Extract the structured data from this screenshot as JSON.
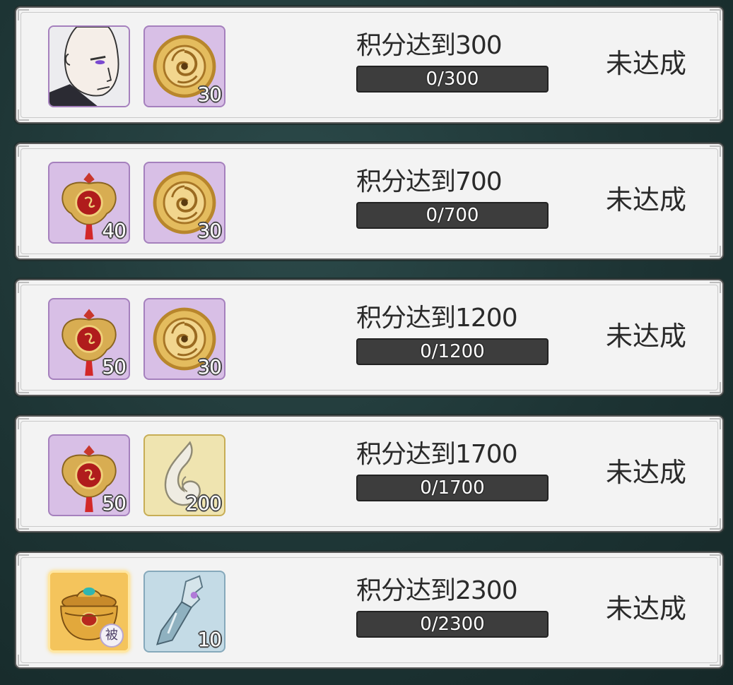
{
  "tasks": [
    {
      "title": "积分达到300",
      "progress_text": "0/300",
      "progress": 0,
      "status": "未达成",
      "rewards": [
        {
          "icon": "character-portrait-icon",
          "frame": "purple",
          "count": ""
        },
        {
          "icon": "gold-coin-icon",
          "frame": "purple",
          "count": "30"
        }
      ]
    },
    {
      "title": "积分达到700",
      "progress_text": "0/700",
      "progress": 0,
      "status": "未达成",
      "rewards": [
        {
          "icon": "charm-amulet-icon",
          "frame": "purple",
          "count": "40"
        },
        {
          "icon": "gold-coin-icon",
          "frame": "purple",
          "count": "30"
        }
      ]
    },
    {
      "title": "积分达到1200",
      "progress_text": "0/1200",
      "progress": 0,
      "status": "未达成",
      "rewards": [
        {
          "icon": "charm-amulet-icon",
          "frame": "purple",
          "count": "50"
        },
        {
          "icon": "gold-coin-icon",
          "frame": "purple",
          "count": "30"
        }
      ]
    },
    {
      "title": "积分达到1700",
      "progress_text": "0/1700",
      "progress": 0,
      "status": "未达成",
      "rewards": [
        {
          "icon": "charm-amulet-icon",
          "frame": "purple",
          "count": "50"
        },
        {
          "icon": "jade-crescent-icon",
          "frame": "yellow",
          "count": "200"
        }
      ]
    },
    {
      "title": "积分达到2300",
      "progress_text": "0/2300",
      "progress": 0,
      "status": "未达成",
      "rewards": [
        {
          "icon": "treasure-urn-icon",
          "frame": "gold",
          "count": "",
          "tag": "被"
        },
        {
          "icon": "blade-weapon-icon",
          "frame": "blue",
          "count": "10"
        }
      ]
    }
  ],
  "colors": {
    "card_bg": "#f3f3f3",
    "progress_bg": "#3d3d3d",
    "page_bg": "#1d3434"
  }
}
